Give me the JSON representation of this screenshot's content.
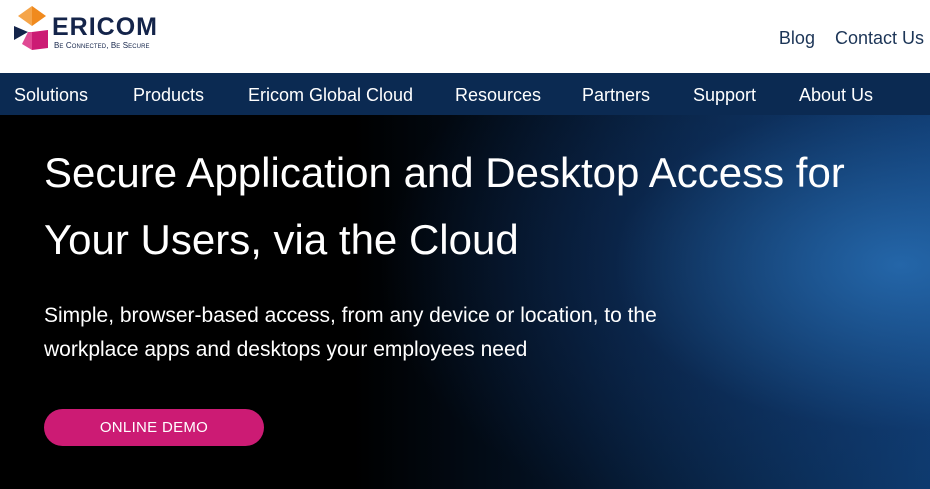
{
  "header": {
    "logo": {
      "wordmark": "ERICOM",
      "tagline": "Be Connected, Be Secure",
      "icon": "ericom-logo-icon"
    },
    "util_links": [
      {
        "label": "Blog"
      },
      {
        "label": "Contact Us"
      }
    ]
  },
  "nav": {
    "items": [
      {
        "label": "Solutions"
      },
      {
        "label": "Products"
      },
      {
        "label": "Ericom Global Cloud"
      },
      {
        "label": "Resources"
      },
      {
        "label": "Partners"
      },
      {
        "label": "Support"
      },
      {
        "label": "About Us"
      }
    ]
  },
  "hero": {
    "title": "Secure Application and Desktop Access for Your Users, via the Cloud",
    "subtitle": "Simple, browser-based access, from any device or location, to the workplace apps and desktops your employees need",
    "cta_label": "ONLINE DEMO"
  },
  "colors": {
    "header_bg": "#ffffff",
    "nav_bg": "#0b2a52",
    "cta_bg": "#cc1b74",
    "logo_orange": "#f08a1e",
    "logo_magenta": "#cc1b74",
    "logo_navy": "#14244a"
  }
}
